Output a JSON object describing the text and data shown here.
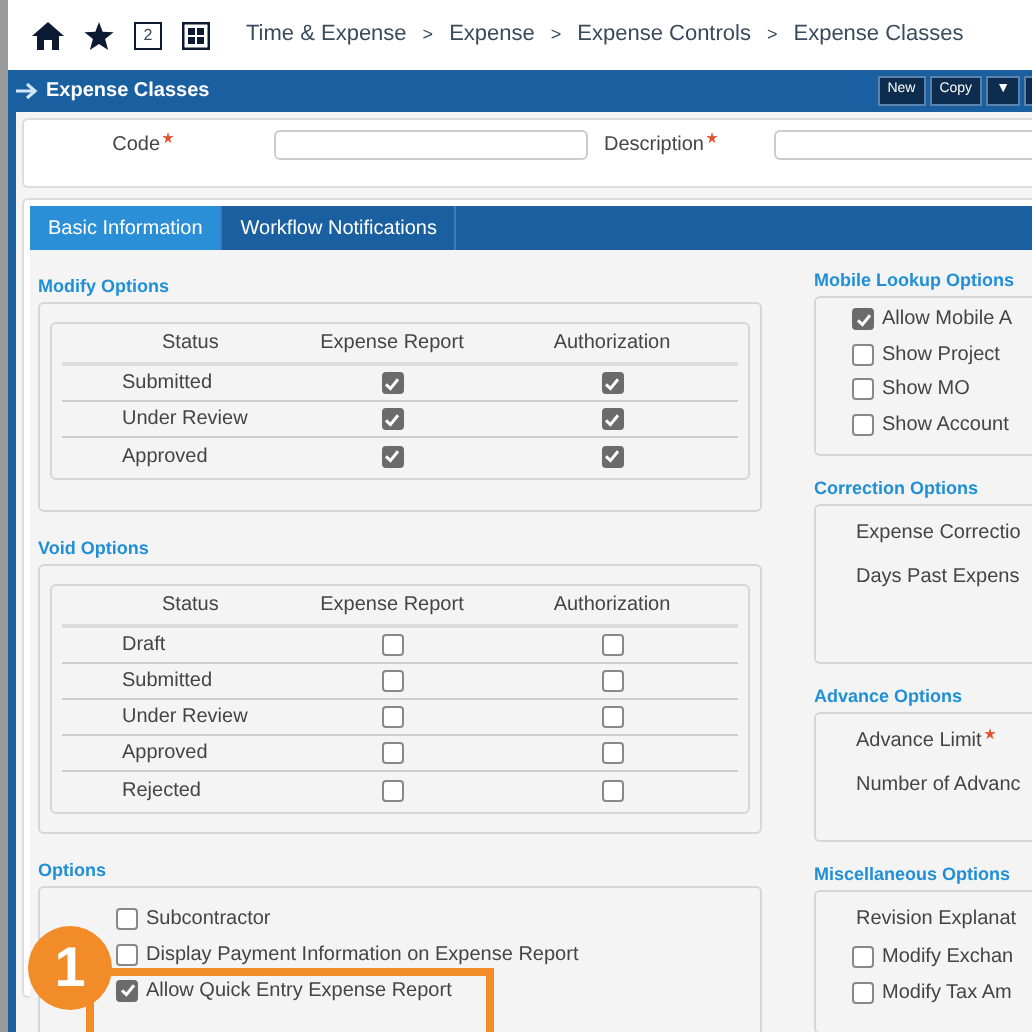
{
  "breadcrumb": {
    "badge": "2",
    "separator": ">",
    "items": [
      "Time & Expense",
      "Expense",
      "Expense Controls",
      "Expense Classes"
    ]
  },
  "header": {
    "title": "Expense Classes",
    "buttons": [
      "New",
      "Copy",
      "▼"
    ]
  },
  "form": {
    "fields": [
      {
        "label": "Code",
        "required": true
      },
      {
        "label": "Description",
        "required": true
      }
    ]
  },
  "tabs": [
    {
      "label": "Basic Information",
      "selected": true
    },
    {
      "label": "Workflow Notifications",
      "selected": false
    }
  ],
  "modify_options": {
    "title": "Modify Options",
    "columns": [
      "Status",
      "Expense Report",
      "Authorization"
    ],
    "rows": [
      {
        "status": "Submitted",
        "expense_report": true,
        "authorization": true
      },
      {
        "status": "Under Review",
        "expense_report": true,
        "authorization": true
      },
      {
        "status": "Approved",
        "expense_report": true,
        "authorization": true
      }
    ]
  },
  "void_options": {
    "title": "Void Options",
    "columns": [
      "Status",
      "Expense Report",
      "Authorization"
    ],
    "rows": [
      {
        "status": "Draft",
        "expense_report": false,
        "authorization": false
      },
      {
        "status": "Submitted",
        "expense_report": false,
        "authorization": false
      },
      {
        "status": "Under Review",
        "expense_report": false,
        "authorization": false
      },
      {
        "status": "Approved",
        "expense_report": false,
        "authorization": false
      },
      {
        "status": "Rejected",
        "expense_report": false,
        "authorization": false
      }
    ]
  },
  "options": {
    "title": "Options",
    "items": [
      {
        "label": "Subcontractor",
        "checked": false
      },
      {
        "label": "Display Payment Information on Expense Report",
        "checked": false
      },
      {
        "label": "Allow Quick Entry Expense Report",
        "checked": true
      }
    ]
  },
  "mobile_lookup_options": {
    "title": "Mobile Lookup Options",
    "items": [
      {
        "label": "Allow Mobile A",
        "checked": true
      },
      {
        "label": "Show Project",
        "checked": false
      },
      {
        "label": "Show MO",
        "checked": false
      },
      {
        "label": "Show Account",
        "checked": false
      }
    ]
  },
  "correction_options": {
    "title": "Correction Options",
    "items": [
      {
        "kind": "label",
        "label": "Expense Correctio"
      },
      {
        "kind": "label",
        "label": "Days Past Expens"
      }
    ]
  },
  "advance_options": {
    "title": "Advance Options",
    "items": [
      {
        "kind": "label",
        "label": "Advance Limit",
        "required": true
      },
      {
        "kind": "label",
        "label": "Number of Advanc",
        "required": false
      }
    ]
  },
  "miscellaneous_options": {
    "title": "Miscellaneous Options",
    "items": [
      {
        "kind": "label",
        "label": "Revision Explanat"
      },
      {
        "kind": "checkbox",
        "label": "Modify Exchan",
        "checked": false
      },
      {
        "kind": "checkbox",
        "label": "Modify Tax Am",
        "checked": false
      }
    ]
  },
  "callout": {
    "number": "1"
  }
}
